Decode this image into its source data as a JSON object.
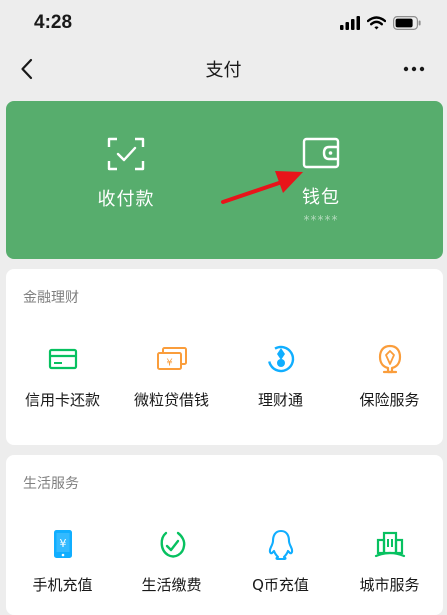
{
  "status_bar": {
    "time": "4:28"
  },
  "nav": {
    "title": "支付"
  },
  "pay_card": {
    "items": [
      {
        "label": "收付款",
        "icon": "scan-frame-check-icon"
      },
      {
        "label": "钱包",
        "icon": "wallet-icon",
        "balance_mask": "*****"
      }
    ]
  },
  "finance": {
    "title": "金融理财",
    "items": [
      {
        "label": "信用卡还款",
        "icon": "credit-card-icon"
      },
      {
        "label": "微粒贷借钱",
        "icon": "loan-yuan-icon"
      },
      {
        "label": "理财通",
        "icon": "wealth-icon"
      },
      {
        "label": "保险服务",
        "icon": "insurance-icon"
      }
    ]
  },
  "life": {
    "title": "生活服务",
    "items": [
      {
        "label": "手机充值",
        "icon": "phone-yuan-icon"
      },
      {
        "label": "生活缴费",
        "icon": "leaf-check-icon"
      },
      {
        "label": "Q币充值",
        "icon": "qq-penguin-icon"
      },
      {
        "label": "城市服务",
        "icon": "city-buildings-icon"
      }
    ]
  },
  "colors": {
    "card_green": "#57ad6d",
    "wechat_green": "#07c160",
    "orange": "#fa9d3b",
    "blue": "#10aeff",
    "annotation_red": "#e8141a"
  }
}
